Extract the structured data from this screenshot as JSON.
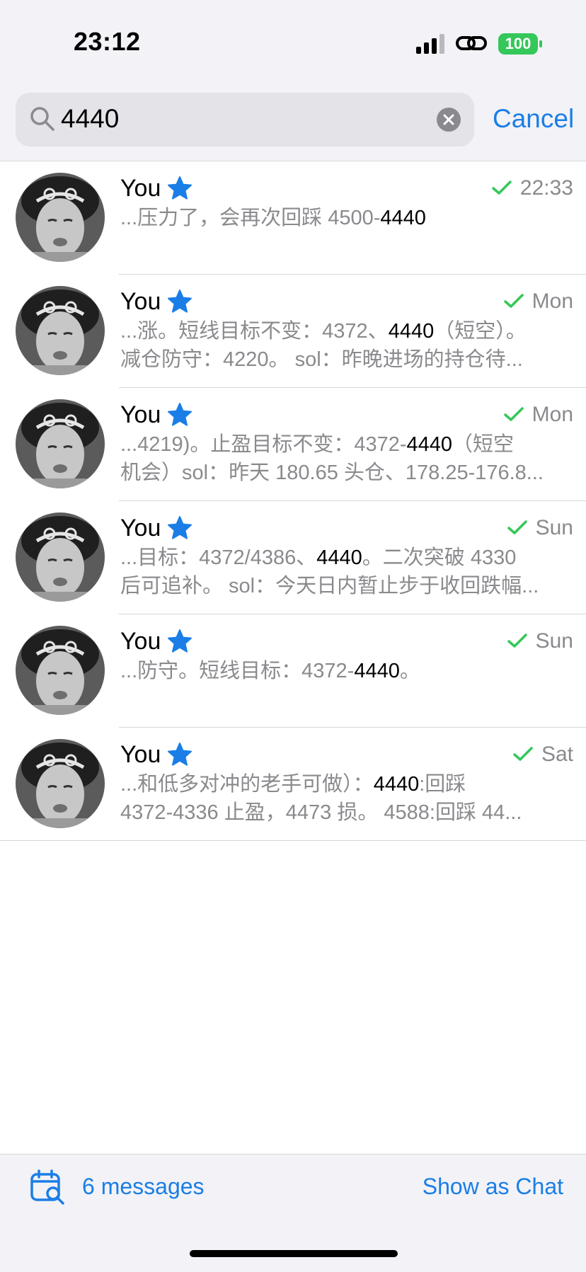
{
  "status_bar": {
    "time": "23:12",
    "battery": "100"
  },
  "search": {
    "query": "4440",
    "cancel_label": "Cancel"
  },
  "results": [
    {
      "sender": "You",
      "date": "22:33",
      "line1": [
        "...压力了，会再次回踩 4500-",
        "4440",
        ""
      ],
      "line2": ""
    },
    {
      "sender": "You",
      "date": "Mon",
      "line1": [
        "...涨。短线目标不变：4372、",
        "4440",
        "（短空）。"
      ],
      "line2": "减仓防守：4220。 sol：昨晚进场的持仓待..."
    },
    {
      "sender": "You",
      "date": "Mon",
      "line1": [
        "...4219)。止盈目标不变：4372-",
        "4440",
        "（短空"
      ],
      "line2": "机会）sol：昨天 180.65 头仓、178.25-176.8..."
    },
    {
      "sender": "You",
      "date": "Sun",
      "line1": [
        "...目标：4372/4386、",
        "4440",
        "。二次突破 4330"
      ],
      "line2": "后可追补。 sol：今天日内暂止步于收回跌幅..."
    },
    {
      "sender": "You",
      "date": "Sun",
      "line1": [
        "...防守。短线目标：4372-",
        "4440",
        "。"
      ],
      "line2": ""
    },
    {
      "sender": "You",
      "date": "Sat",
      "line1": [
        "...和低多对冲的老手可做）：",
        "4440",
        ":回踩"
      ],
      "line2": "4372-4336 止盈，4473 损。 4588:回踩 44..."
    }
  ],
  "footer": {
    "count_label": "6 messages",
    "show_as_chat_label": "Show as Chat"
  },
  "colors": {
    "accent": "#1a7ee6",
    "check": "#34c759",
    "battery": "#34c759",
    "background": "#f2f2f7"
  },
  "icons": [
    "signal-icon",
    "link-icon",
    "battery-icon",
    "search-icon",
    "clear-icon",
    "star-icon",
    "checkmark-icon",
    "calendar-search-icon"
  ]
}
